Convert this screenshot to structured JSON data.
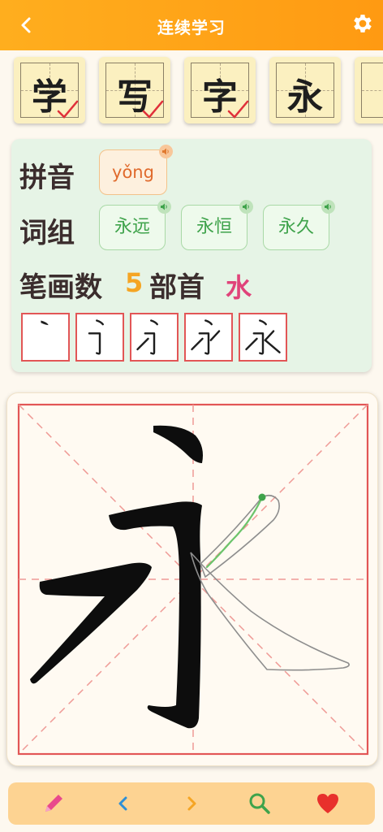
{
  "header": {
    "title": "连续学习",
    "back_icon": "chevron-left-icon",
    "settings_icon": "gear-icon"
  },
  "char_strip": [
    {
      "char": "学",
      "completed": true
    },
    {
      "char": "写",
      "completed": true
    },
    {
      "char": "字",
      "completed": true
    },
    {
      "char": "永",
      "completed": false
    }
  ],
  "info": {
    "pinyin_label": "拼音",
    "pinyin": "yǒng",
    "words_label": "词组",
    "words": [
      "永远",
      "永恒",
      "永久"
    ],
    "stroke_count_label": "笔画数",
    "stroke_count": "5",
    "radical_label": "部首",
    "radical": "水",
    "stroke_steps": 5
  },
  "bottom_bar": {
    "icons": [
      "pencil-icon",
      "chevron-left-icon",
      "chevron-right-icon",
      "search-icon",
      "heart-icon"
    ]
  },
  "colors": {
    "header": "#ff9f16",
    "accent_orange": "#f5a524",
    "radical_pink": "#e0437a",
    "word_green": "#3fa34b",
    "grid_red": "#e25656"
  }
}
